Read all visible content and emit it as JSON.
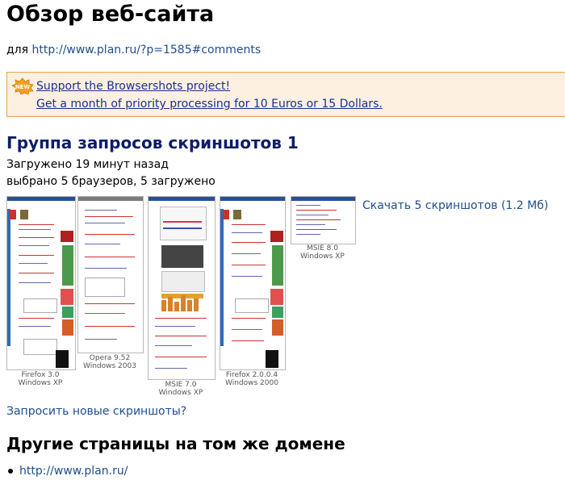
{
  "header": {
    "title": "Обзор веб-сайта",
    "for_label": "для",
    "url": "http://www.plan.ru/?p=1585#comments"
  },
  "promo": {
    "badge": "NEW",
    "link1": "Support the Browsershots project!",
    "link2": "Get a month of priority processing for 10 Euros or 15 Dollars.",
    "accent": "#e8a04c",
    "background": "#fdf0e0"
  },
  "group": {
    "heading": "Группа запросов скриншотов 1",
    "uploaded": "Загружено 19 минут назад",
    "selected": "выбрано 5 браузеров, 5 загружено",
    "download": "Скачать 5 скриншотов (1.2 Мб)"
  },
  "screenshots": [
    {
      "browser": "Firefox 3.0",
      "os": "Windows XP"
    },
    {
      "browser": "Opera 9.52",
      "os": "Windows 2003"
    },
    {
      "browser": "MSIE 7.0",
      "os": "Windows XP"
    },
    {
      "browser": "Firefox 2.0.0.4",
      "os": "Windows 2000"
    },
    {
      "browser": "MSIE 8.0",
      "os": "Windows XP"
    }
  ],
  "request_new": "Запросить новые скриншоты?",
  "other": {
    "heading": "Другие страницы на том же домене",
    "links": [
      "http://www.plan.ru/"
    ]
  }
}
